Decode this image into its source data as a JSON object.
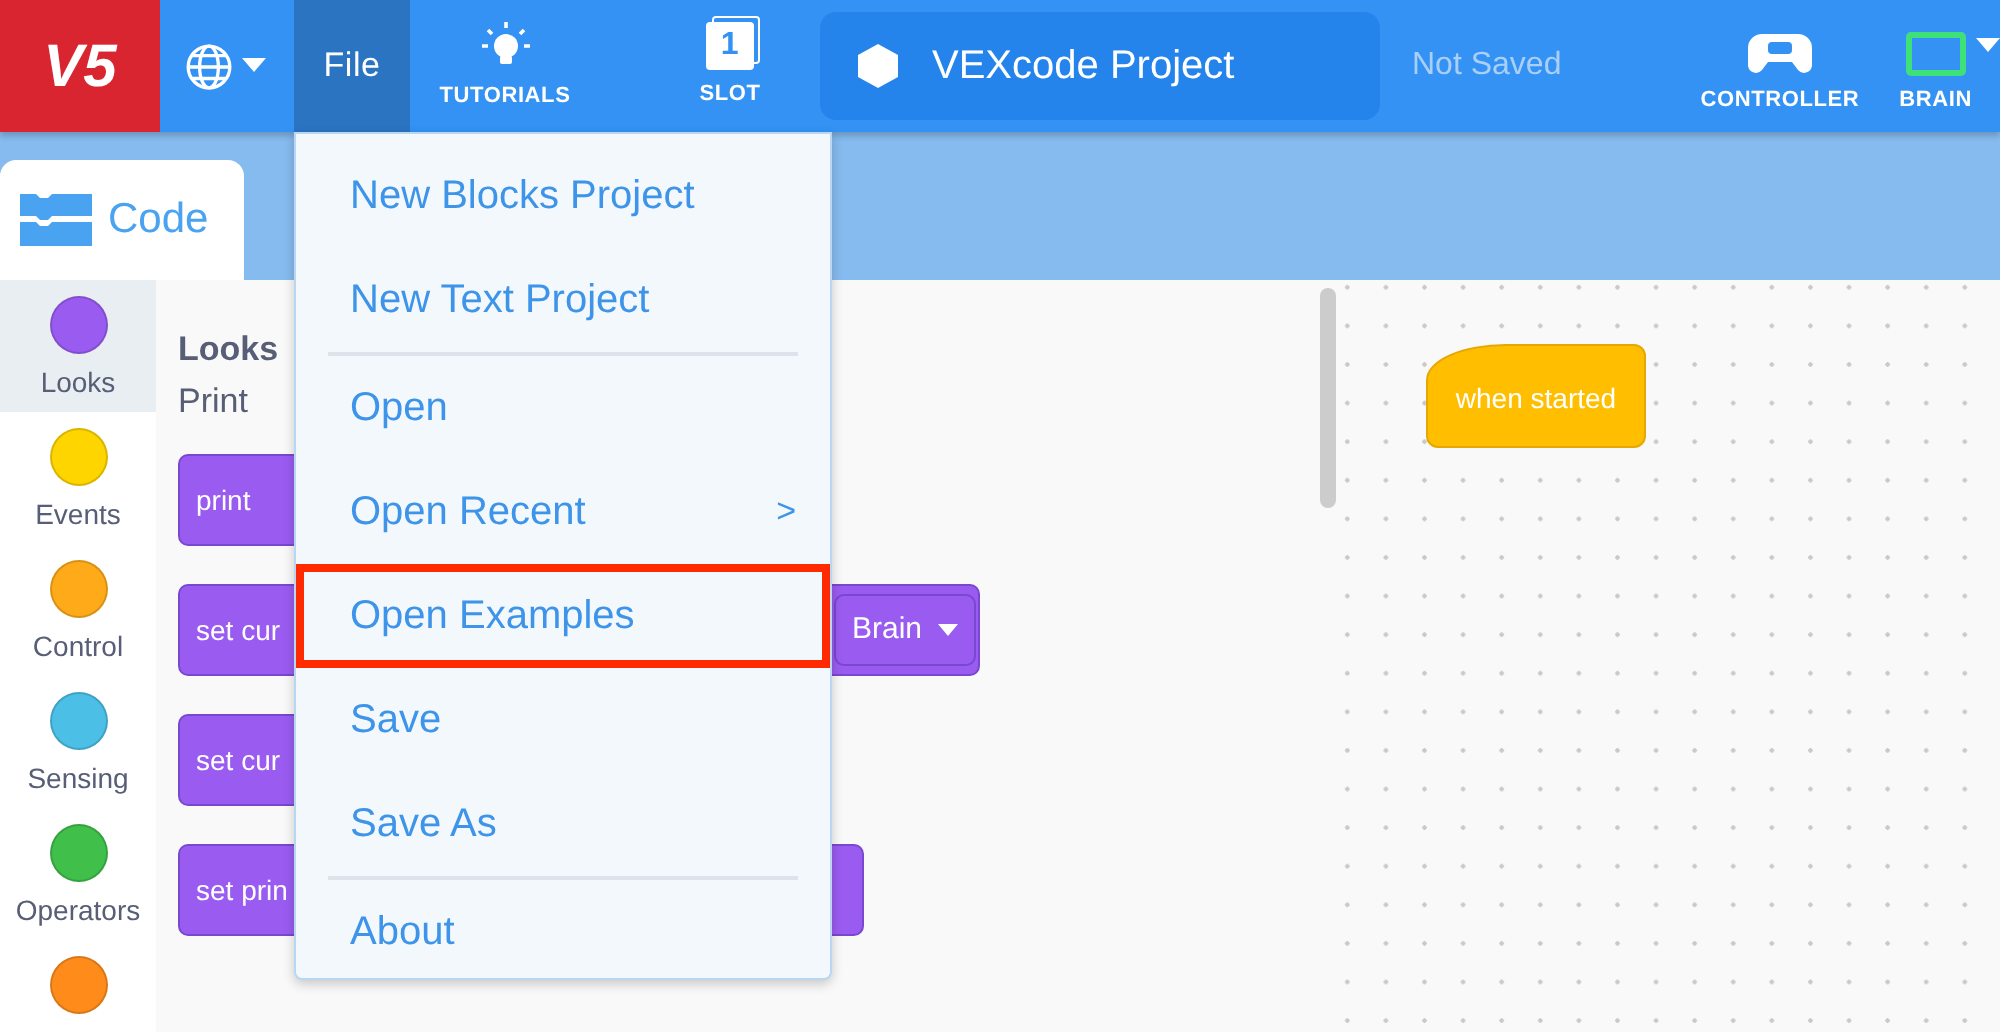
{
  "topbar": {
    "logo": "V5",
    "file_button": {
      "label": "File",
      "selected": true
    },
    "tutorials": "TUTORIALS",
    "slot": {
      "number": "1",
      "label": "SLOT"
    },
    "project_name": "VEXcode Project",
    "save_status": "Not Saved",
    "controller": "CONTROLLER",
    "brain": "BRAIN"
  },
  "editor_tab": {
    "label": "Code",
    "selected": true
  },
  "categories": [
    {
      "label": "Looks",
      "color": "#9a5cf0",
      "selected": true
    },
    {
      "label": "Events",
      "color": "#ffd500",
      "selected": false
    },
    {
      "label": "Control",
      "color": "#ffab19",
      "selected": false
    },
    {
      "label": "Sensing",
      "color": "#4cbfe6",
      "selected": false
    },
    {
      "label": "Operators",
      "color": "#40bf4a",
      "selected": false
    },
    {
      "color": "#ff8c1a",
      "selected": false
    }
  ],
  "palette": {
    "heading": "Looks",
    "subheading": "Print",
    "blocks": [
      {
        "text": "print"
      },
      {
        "text": "set cur",
        "dropdown": "Brain"
      },
      {
        "text": "set cur"
      },
      {
        "text": "set prin"
      }
    ]
  },
  "file_menu": {
    "items": [
      {
        "label": "New Blocks Project",
        "highlighted": false,
        "divider_after": false
      },
      {
        "label": "New Text Project",
        "highlighted": false,
        "divider_after": true
      },
      {
        "label": "Open",
        "highlighted": false,
        "divider_after": false
      },
      {
        "label": "Open Recent",
        "submenu": ">",
        "highlighted": false,
        "divider_after": false
      },
      {
        "label": "Open Examples",
        "highlighted": true,
        "divider_after": false
      },
      {
        "label": "Save",
        "highlighted": false,
        "divider_after": false
      },
      {
        "label": "Save As",
        "highlighted": false,
        "divider_after": true
      },
      {
        "label": "About",
        "highlighted": false,
        "divider_after": false
      }
    ]
  },
  "workspace": {
    "blocks": [
      {
        "kind": "hat",
        "text": "when started"
      }
    ]
  }
}
